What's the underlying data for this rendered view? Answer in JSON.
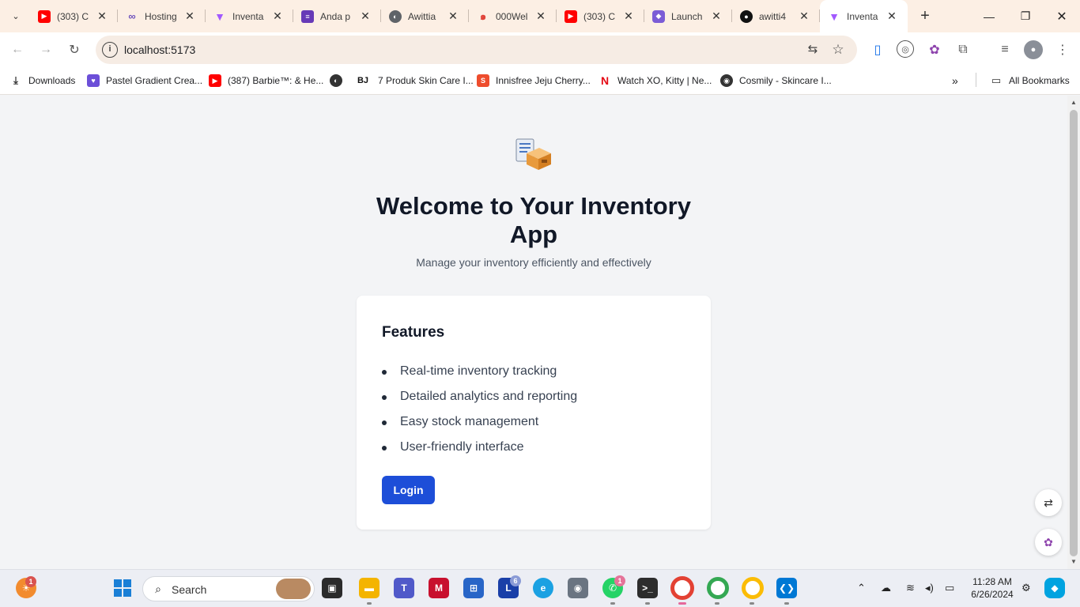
{
  "browser": {
    "tabs": [
      {
        "title": "(303) C",
        "favicon": "youtube-icon",
        "color": "#ff0000",
        "active": false
      },
      {
        "title": "Hosting",
        "favicon": "infinity-icon",
        "color": "#6b4fbb",
        "active": false
      },
      {
        "title": "Inventa",
        "favicon": "vite-icon",
        "color": "#a259ff",
        "active": false
      },
      {
        "title": "Anda p",
        "favicon": "forms-icon",
        "color": "#673ab7",
        "active": false
      },
      {
        "title": "Awittia",
        "favicon": "globe-icon",
        "color": "#5f6368",
        "active": false
      },
      {
        "title": "000Wel",
        "favicon": "000webhost-icon",
        "color": "#e0443a",
        "active": false
      },
      {
        "title": "(303) C",
        "favicon": "youtube-icon",
        "color": "#ff0000",
        "active": false
      },
      {
        "title": "Launch",
        "favicon": "launch-icon",
        "color": "#7b5cd6",
        "active": false
      },
      {
        "title": "awitti4",
        "favicon": "github-icon",
        "color": "#111111",
        "active": false
      },
      {
        "title": "Inventa",
        "favicon": "vite-icon",
        "color": "#a259ff",
        "active": true
      }
    ],
    "new_tab_label": "+",
    "address": "localhost:5173",
    "bookmarks": [
      {
        "label": "Downloads",
        "icon": "download-icon"
      },
      {
        "label": "Pastel Gradient Crea...",
        "icon": "heart-icon"
      },
      {
        "label": "(387) Barbie™: & He...",
        "icon": "youtube-icon"
      },
      {
        "label": "",
        "icon": "globe-icon"
      },
      {
        "label": "7 Produk Skin Care I...",
        "icon": "bj-icon"
      },
      {
        "label": "Innisfree Jeju Cherry...",
        "icon": "shopee-icon"
      },
      {
        "label": "Watch XO, Kitty | Ne...",
        "icon": "netflix-icon"
      },
      {
        "label": "Cosmily - Skincare I...",
        "icon": "cosmily-icon"
      }
    ],
    "all_bookmarks_label": "All Bookmarks"
  },
  "app": {
    "title": "Welcome to Your Inventory App",
    "subtitle": "Manage your inventory efficiently and effectively",
    "features_heading": "Features",
    "features": [
      "Real-time inventory tracking",
      "Detailed analytics and reporting",
      "Easy stock management",
      "User-friendly interface"
    ],
    "login_label": "Login",
    "accent_color": "#1d4ed8"
  },
  "taskbar": {
    "search_label": "Search",
    "time": "11:28 AM",
    "date": "6/26/2024",
    "badges": {
      "weather": "1",
      "lumin": "6",
      "whatsapp": "1"
    }
  }
}
